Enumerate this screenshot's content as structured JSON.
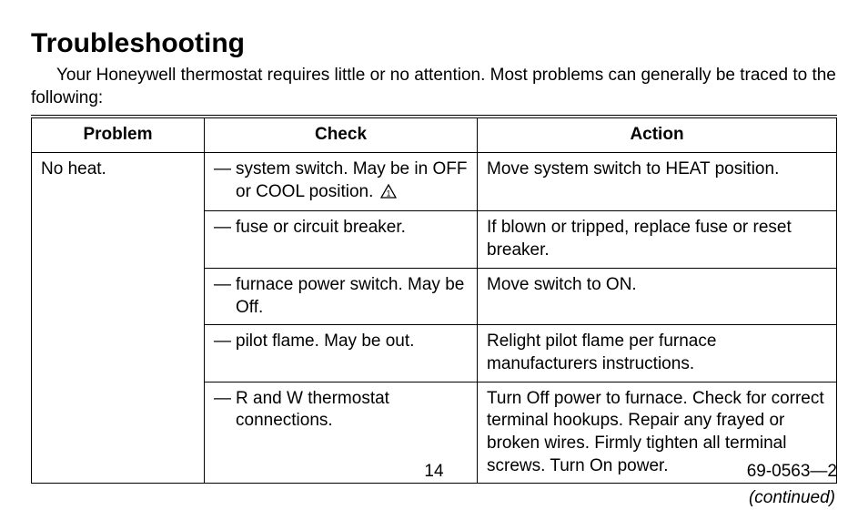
{
  "title": "Troubleshooting",
  "intro": "Your Honeywell thermostat requires little or no attention. Most problems can generally be traced to the following:",
  "columns": {
    "problem": "Problem",
    "check": "Check",
    "action": "Action"
  },
  "problem": "No heat.",
  "rows": [
    {
      "check": "system switch. May be in OFF or COOL position.",
      "has_warn": true,
      "warn_num": "1",
      "action": "Move system switch to HEAT position."
    },
    {
      "check": "fuse or circuit breaker.",
      "has_warn": false,
      "action": "If blown or tripped, replace fuse or reset breaker."
    },
    {
      "check": "furnace power switch. May be Off.",
      "has_warn": false,
      "action": "Move switch to ON."
    },
    {
      "check": "pilot flame. May be out.",
      "has_warn": false,
      "action": "Relight pilot flame per furnace manufacturers instructions."
    },
    {
      "check": "R and W thermostat connections.",
      "has_warn": false,
      "action": "Turn Off power to furnace. Check for correct terminal hookups. Repair any frayed or broken wires. Firmly tighten all terminal screws. Turn On power."
    }
  ],
  "continued": "(continued)",
  "page_number": "14",
  "doc_number": "69-0563—2",
  "dash": "—"
}
